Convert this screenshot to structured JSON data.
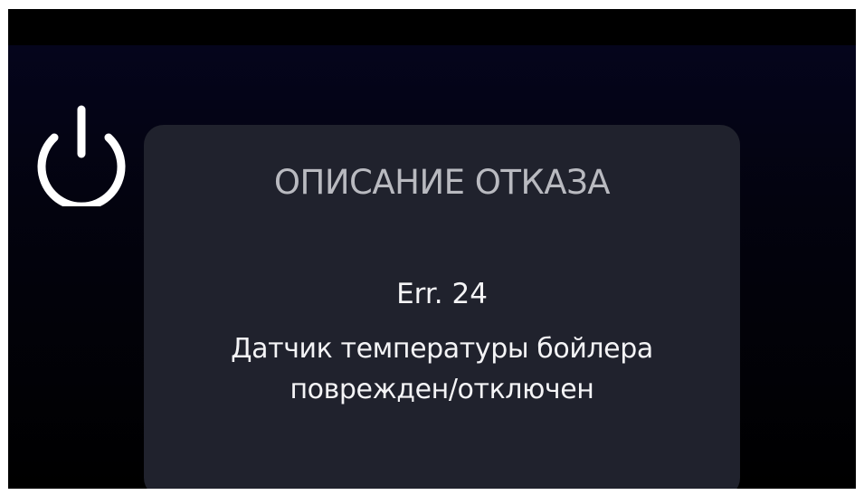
{
  "power": {
    "icon": "power-icon",
    "color": "#ffffff"
  },
  "dialog": {
    "title": "ОПИСАНИЕ ОТКАЗА",
    "error_code": "Err. 24",
    "description_lines": [
      "Датчик температуры бойлера",
      "поврежден/отключен"
    ],
    "background": "#20222d"
  }
}
